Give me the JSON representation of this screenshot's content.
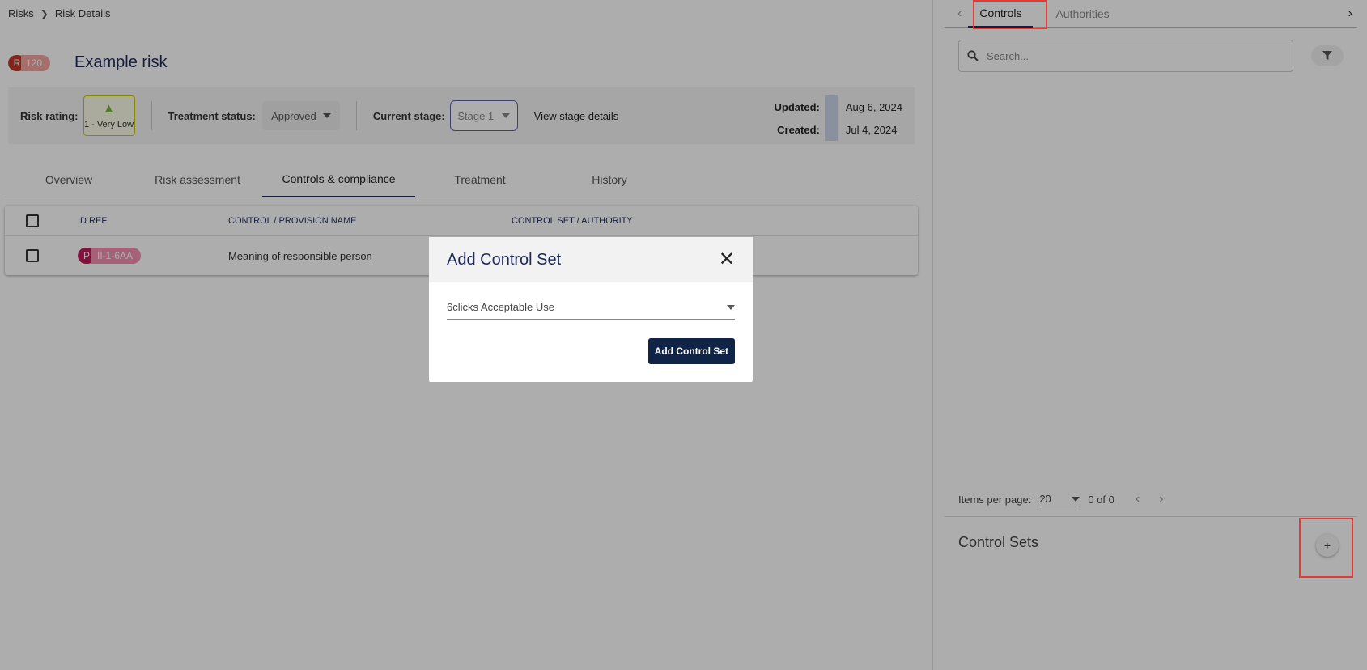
{
  "breadcrumb": {
    "root": "Risks",
    "current": "Risk Details"
  },
  "risk": {
    "badge_letter": "R",
    "badge_number": "120",
    "title": "Example risk"
  },
  "info": {
    "rating_label": "Risk rating:",
    "rating_value": "1 - Very Low",
    "treatment_label": "Treatment status:",
    "treatment_value": "Approved",
    "stage_label": "Current stage:",
    "stage_value": "Stage 1",
    "view_stage": "View stage details",
    "updated_label": "Updated:",
    "updated_value": "Aug 6, 2024",
    "created_label": "Created:",
    "created_value": "Jul 4, 2024"
  },
  "tabs": [
    {
      "label": "Overview"
    },
    {
      "label": "Risk assessment"
    },
    {
      "label": "Controls & compliance"
    },
    {
      "label": "Treatment"
    },
    {
      "label": "History"
    }
  ],
  "table": {
    "headers": {
      "id": "ID REF",
      "name": "CONTROL / PROVISION NAME",
      "set": "CONTROL SET / AUTHORITY"
    },
    "rows": [
      {
        "badge_letter": "P",
        "id": "II-1-6AA",
        "name": "Meaning of responsible person"
      }
    ]
  },
  "panel": {
    "tabs": {
      "controls": "Controls",
      "authorities": "Authorities"
    },
    "search_placeholder": "Search...",
    "items_per_page_label": "Items per page:",
    "items_per_page_value": "20",
    "range": "0 of 0",
    "control_sets_title": "Control Sets",
    "add_symbol": "+"
  },
  "modal": {
    "title": "Add Control Set",
    "close_symbol": "✕",
    "selected": "6clicks Acceptable Use",
    "button": "Add Control Set"
  }
}
